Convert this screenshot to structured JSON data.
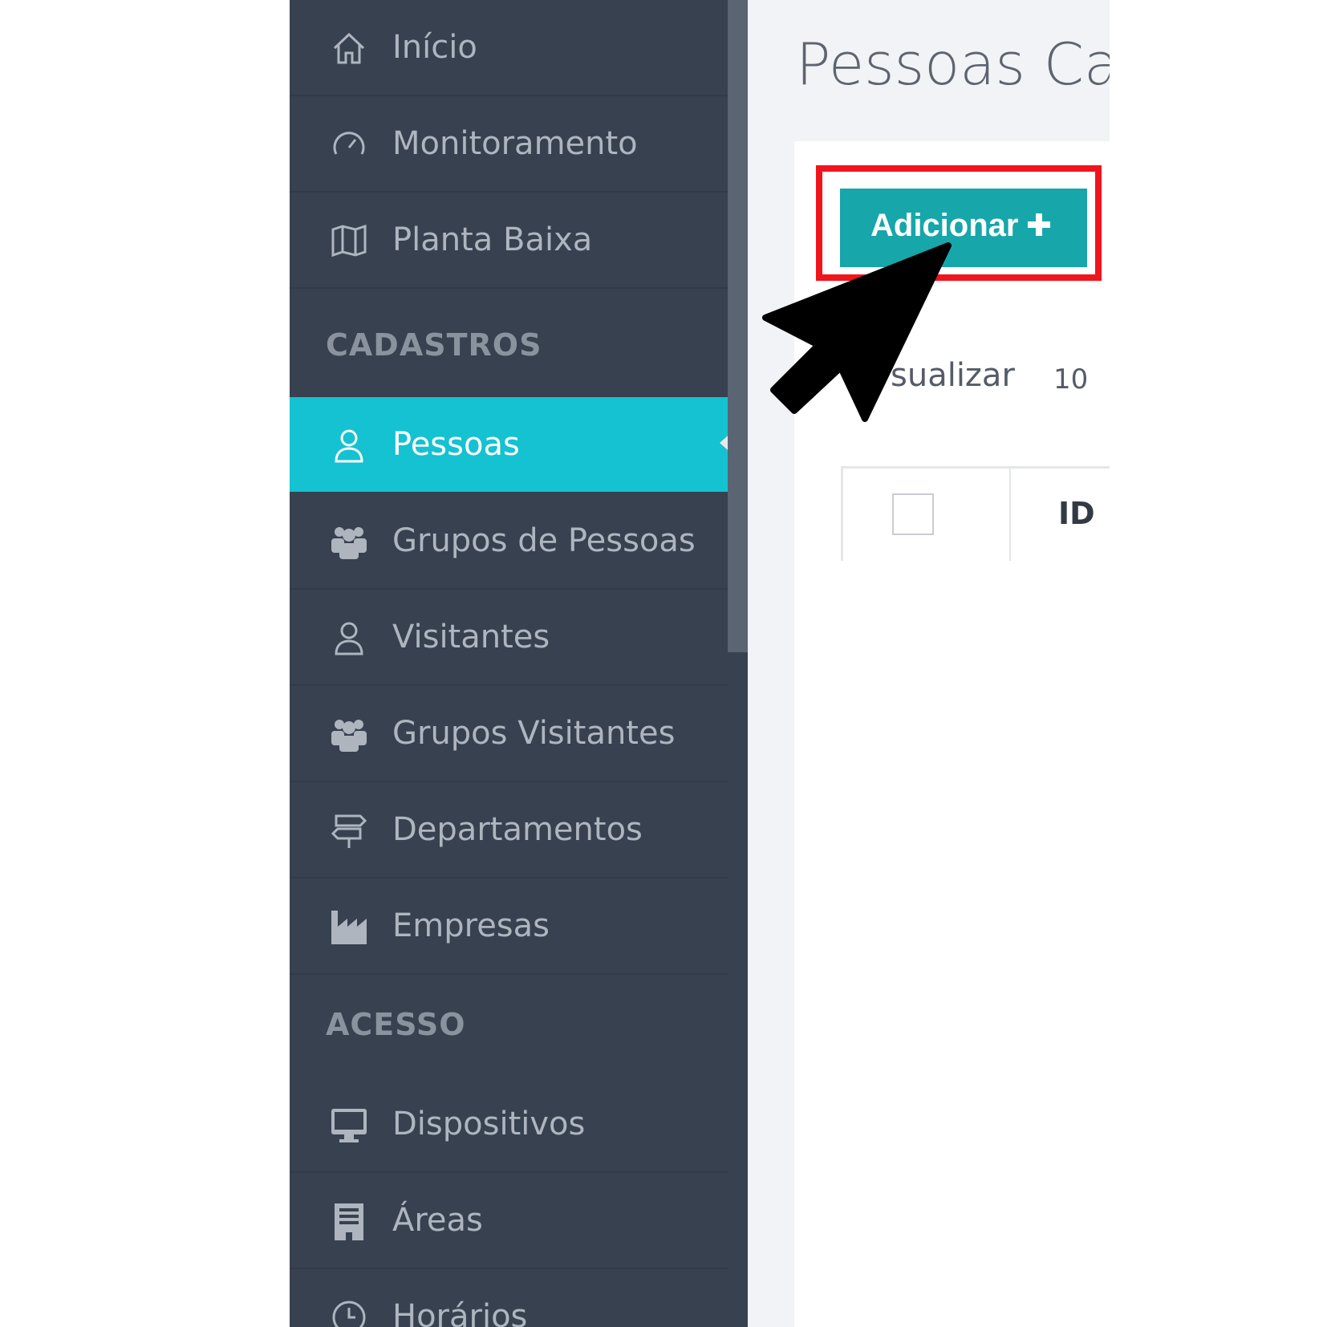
{
  "sidebar": {
    "items": [
      {
        "label": "Início",
        "icon": "home-icon"
      },
      {
        "label": "Monitoramento",
        "icon": "gauge-icon"
      },
      {
        "label": "Planta Baixa",
        "icon": "map-icon"
      },
      {
        "label": "Pessoas",
        "icon": "user-icon",
        "active": true
      },
      {
        "label": "Grupos de Pessoas",
        "icon": "users-icon"
      },
      {
        "label": "Visitantes",
        "icon": "user-outline-icon"
      },
      {
        "label": "Grupos Visitantes",
        "icon": "users-icon"
      },
      {
        "label": "Departamentos",
        "icon": "signpost-icon"
      },
      {
        "label": "Empresas",
        "icon": "factory-icon"
      },
      {
        "label": "Dispositivos",
        "icon": "monitor-icon"
      },
      {
        "label": "Áreas",
        "icon": "building-icon"
      },
      {
        "label": "Horários",
        "icon": "clock-icon"
      }
    ],
    "sections": {
      "cadastros": "CADASTROS",
      "acesso": "ACESSO"
    }
  },
  "main": {
    "title": "Pessoas Cad",
    "add_button": "Adicionar",
    "add_button_icon": "plus-icon",
    "visualizar_label": "sualizar",
    "page_size": "10",
    "table": {
      "id_header": "ID"
    }
  },
  "colors": {
    "sidebar_bg": "#374150",
    "active_item": "#14c2d1",
    "button": "#17a6aa",
    "highlight": "#f0141c"
  }
}
